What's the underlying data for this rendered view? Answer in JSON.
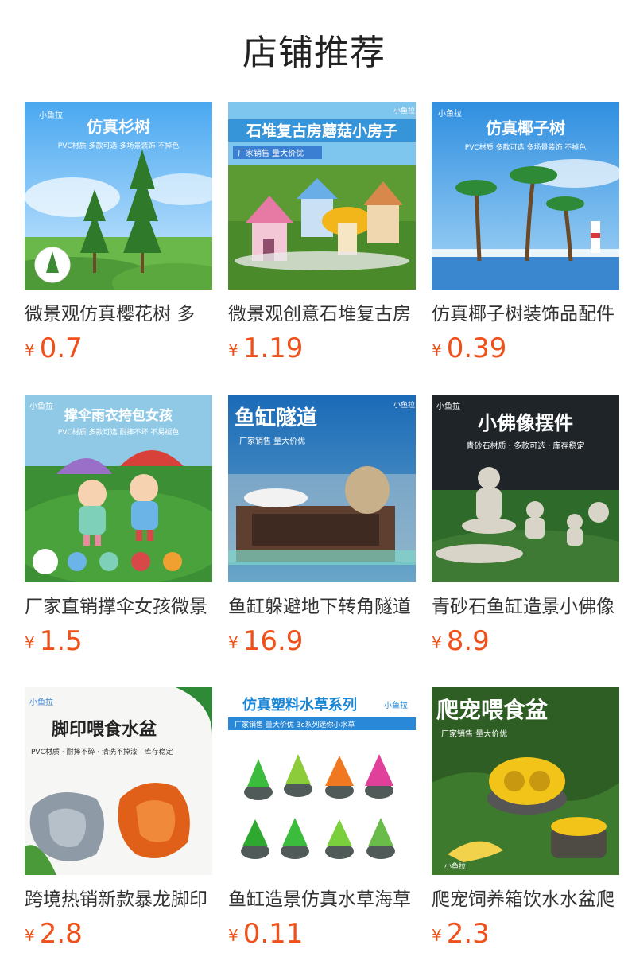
{
  "page_title": "店铺推荐",
  "currency": "¥",
  "brand_mark": "小鱼拉",
  "products": [
    {
      "name": "微景观仿真樱花树 多",
      "price": "0.7",
      "banner": {
        "title": "仿真杉树",
        "subtitle": "PVC材质 多款可选 多场景装饰 不掉色"
      }
    },
    {
      "name": "微景观创意石堆复古房",
      "price": "1.19",
      "banner": {
        "title": "石堆复古房蘑菇小房子",
        "subtitle": "厂家销售  量大价优"
      }
    },
    {
      "name": "仿真椰子树装饰品配件",
      "price": "0.39",
      "banner": {
        "title": "仿真椰子树",
        "subtitle": "PVC材质 多款可选 多场景装饰 不掉色"
      }
    },
    {
      "name": "厂家直销撑伞女孩微景",
      "price": "1.5",
      "banner": {
        "title": "撑伞雨衣挎包女孩",
        "subtitle": "PVC材质  多款可选  耐摔不坏  不易褪色"
      }
    },
    {
      "name": "鱼缸躲避地下转角隧道",
      "price": "16.9",
      "banner": {
        "title": "鱼缸隧道",
        "subtitle": "厂家销售  量大价优"
      }
    },
    {
      "name": "青砂石鱼缸造景小佛像",
      "price": "8.9",
      "banner": {
        "title": "小佛像摆件",
        "subtitle": "青砂石材质 · 多款可选 · 库存稳定"
      }
    },
    {
      "name": "跨境热销新款暴龙脚印",
      "price": "2.8",
      "banner": {
        "title": "脚印喂食水盆",
        "subtitle": "PVC材质 · 耐摔不碎 · 清洗不掉漆 · 库存稳定"
      }
    },
    {
      "name": "鱼缸造景仿真水草海草",
      "price": "0.11",
      "banner": {
        "title": "仿真塑料水草系列",
        "subtitle": "厂家销售  量大价优      3c系列迷你小水草"
      }
    },
    {
      "name": "爬宠饲养箱饮水水盆爬",
      "price": "2.3",
      "banner": {
        "title": "爬宠喂食盆",
        "subtitle": "厂家销售  量大价优"
      }
    }
  ],
  "colors": {
    "price": "#f0501a",
    "title": "#222222",
    "text": "#333333"
  }
}
